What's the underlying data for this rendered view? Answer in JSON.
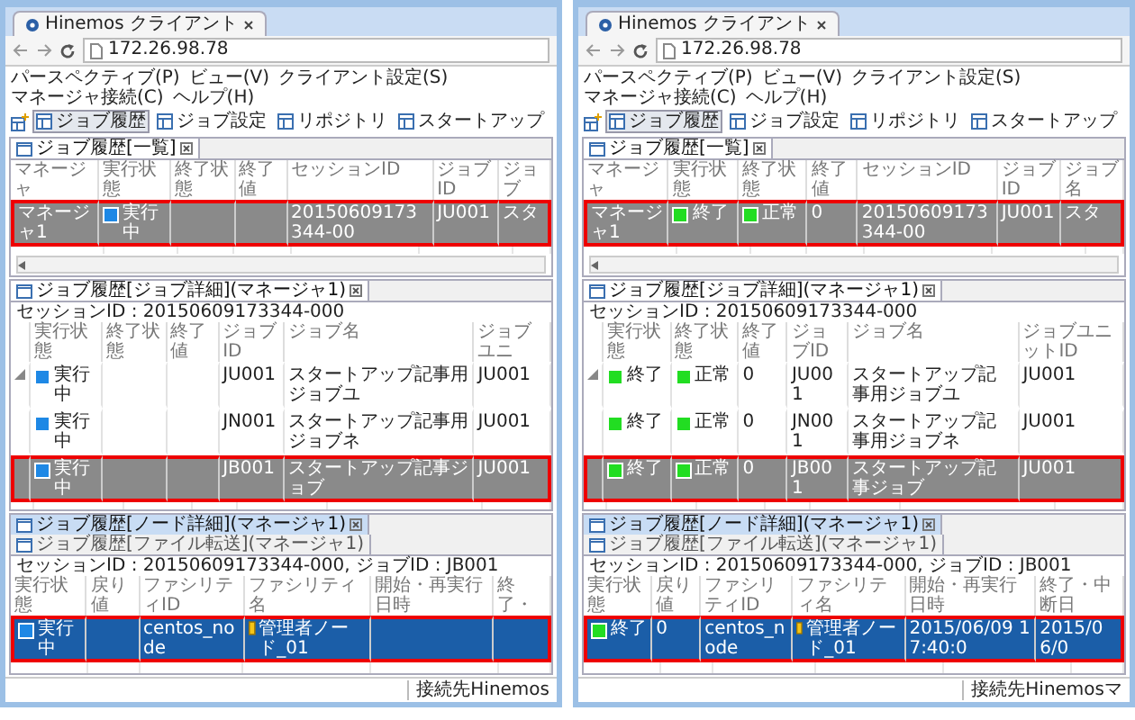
{
  "windows": [
    {
      "browser_tab": "Hinemos クライアント",
      "url": "172.26.98.78",
      "menu": [
        "パースペクティブ(P)",
        "ビュー(V)",
        "クライアント設定(S)",
        "マネージャ接続(C)",
        "ヘルプ(H)"
      ],
      "toolbar": [
        {
          "label": "ジョブ履歴",
          "selected": true
        },
        {
          "label": "ジョブ設定",
          "selected": false
        },
        {
          "label": "リポジトリ",
          "selected": false
        },
        {
          "label": "スタートアップ",
          "selected": false
        }
      ],
      "list_view": {
        "tab": "ジョブ履歴[一覧]",
        "active": false,
        "columns": [
          "マネージャ",
          "実行状態",
          "終了状態",
          "終了値",
          "セッションID",
          "ジョブID",
          "ジョブ"
        ],
        "rows": [
          {
            "selected": true,
            "cells": [
              {
                "text": "マネージャ1"
              },
              {
                "text": "実行中",
                "color": "#1e88e5"
              },
              {},
              {},
              {
                "text": "20150609173344-00"
              },
              {
                "text": "JU001"
              },
              {
                "text": "スタ"
              }
            ]
          }
        ]
      },
      "detail_view": {
        "tab": "ジョブ履歴[ジョブ詳細](マネージャ1)",
        "active": false,
        "info": "セッションID : 20150609173344-000",
        "columns": [
          "",
          "実行状態",
          "終了状態",
          "終了値",
          "ジョブID",
          "ジョブ名",
          "ジョブユニ"
        ],
        "rows": [
          {
            "selected": false,
            "expanded": true,
            "cells": [
              {},
              {
                "text": "実行中",
                "color": "#1e88e5"
              },
              {},
              {},
              {
                "text": "JU001"
              },
              {
                "text": "スタートアップ記事用ジョブユ"
              },
              {
                "text": "JU001"
              }
            ]
          },
          {
            "selected": false,
            "cells": [
              {},
              {
                "text": "実行中",
                "color": "#1e88e5"
              },
              {},
              {},
              {
                "text": "JN001"
              },
              {
                "text": "スタートアップ記事用ジョブネ"
              },
              {
                "text": "JU001"
              }
            ]
          },
          {
            "selected": true,
            "cells": [
              {},
              {
                "text": "実行中",
                "color": "#1e88e5"
              },
              {},
              {},
              {
                "text": "JB001"
              },
              {
                "text": "スタートアップ記事ジョブ"
              },
              {
                "text": "JU001"
              }
            ]
          }
        ]
      },
      "node_view": {
        "tabs": [
          {
            "label": "ジョブ履歴[ノード詳細](マネージャ1)",
            "selected": true
          },
          {
            "label": "ジョブ履歴[ファイル転送](マネージャ1)",
            "selected": false
          }
        ],
        "active": true,
        "info": "セッションID : 20150609173344-000,  ジョブID : JB001",
        "columns": [
          "実行状態",
          "戻り値",
          "ファシリティID",
          "ファシリティ名",
          "開始・再実行日時",
          "終了・"
        ],
        "rows": [
          {
            "selected": true,
            "cells": [
              {
                "text": "実行中",
                "color": "#1e88e5"
              },
              {},
              {
                "text": "centos_node"
              },
              {
                "text": "管理者ノード_01",
                "node": true
              },
              {},
              {}
            ]
          }
        ]
      },
      "status_bar": "接続先Hinemos"
    },
    {
      "browser_tab": "Hinemos クライアント",
      "url": "172.26.98.78",
      "menu": [
        "パースペクティブ(P)",
        "ビュー(V)",
        "クライアント設定(S)",
        "マネージャ接続(C)",
        "ヘルプ(H)"
      ],
      "toolbar": [
        {
          "label": "ジョブ履歴",
          "selected": true
        },
        {
          "label": "ジョブ設定",
          "selected": false
        },
        {
          "label": "リポジトリ",
          "selected": false
        },
        {
          "label": "スタートアップ",
          "selected": false
        }
      ],
      "list_view": {
        "tab": "ジョブ履歴[一覧]",
        "active": false,
        "columns": [
          "マネージャ",
          "実行状態",
          "終了状態",
          "終了値",
          "セッションID",
          "ジョブID",
          "ジョブ名"
        ],
        "rows": [
          {
            "selected": true,
            "cells": [
              {
                "text": "マネージャ1"
              },
              {
                "text": "終了",
                "color": "#22dd22"
              },
              {
                "text": "正常",
                "color": "#22dd22"
              },
              {
                "text": "0"
              },
              {
                "text": "20150609173344-00"
              },
              {
                "text": "JU001"
              },
              {
                "text": "スタ"
              }
            ]
          }
        ]
      },
      "detail_view": {
        "tab": "ジョブ履歴[ジョブ詳細](マネージャ1)",
        "active": false,
        "info": "セッションID : 20150609173344-000",
        "columns": [
          "",
          "実行状態",
          "終了状態",
          "終了値",
          "ジョブID",
          "ジョブ名",
          "ジョブユニットID"
        ],
        "rows": [
          {
            "selected": false,
            "expanded": true,
            "cells": [
              {},
              {
                "text": "終了",
                "color": "#22dd22"
              },
              {
                "text": "正常",
                "color": "#22dd22"
              },
              {
                "text": "0"
              },
              {
                "text": "JU001"
              },
              {
                "text": "スタートアップ記事用ジョブユ"
              },
              {
                "text": "JU001"
              }
            ]
          },
          {
            "selected": false,
            "cells": [
              {},
              {
                "text": "終了",
                "color": "#22dd22"
              },
              {
                "text": "正常",
                "color": "#22dd22"
              },
              {
                "text": "0"
              },
              {
                "text": "JN001"
              },
              {
                "text": "スタートアップ記事用ジョブネ"
              },
              {
                "text": "JU001"
              }
            ]
          },
          {
            "selected": true,
            "cells": [
              {},
              {
                "text": "終了",
                "color": "#22dd22"
              },
              {
                "text": "正常",
                "color": "#22dd22"
              },
              {
                "text": "0"
              },
              {
                "text": "JB001"
              },
              {
                "text": "スタートアップ記事ジョブ"
              },
              {
                "text": "JU001"
              }
            ]
          }
        ]
      },
      "node_view": {
        "tabs": [
          {
            "label": "ジョブ履歴[ノード詳細](マネージャ1)",
            "selected": true
          },
          {
            "label": "ジョブ履歴[ファイル転送](マネージャ1)",
            "selected": false
          }
        ],
        "active": true,
        "info": "セッションID : 20150609173344-000,  ジョブID : JB001",
        "columns": [
          "実行状態",
          "戻り値",
          "ファシリティID",
          "ファシリティ名",
          "開始・再実行日時",
          "終了・中断日"
        ],
        "rows": [
          {
            "selected": true,
            "cells": [
              {
                "text": "終了",
                "color": "#22dd22"
              },
              {
                "text": "0"
              },
              {
                "text": "centos_node"
              },
              {
                "text": "管理者ノード_01",
                "node": true
              },
              {
                "text": "2015/06/09 17:40:0"
              },
              {
                "text": "2015/06/0"
              }
            ]
          }
        ]
      },
      "status_bar": "接続先Hinemosマ"
    }
  ]
}
